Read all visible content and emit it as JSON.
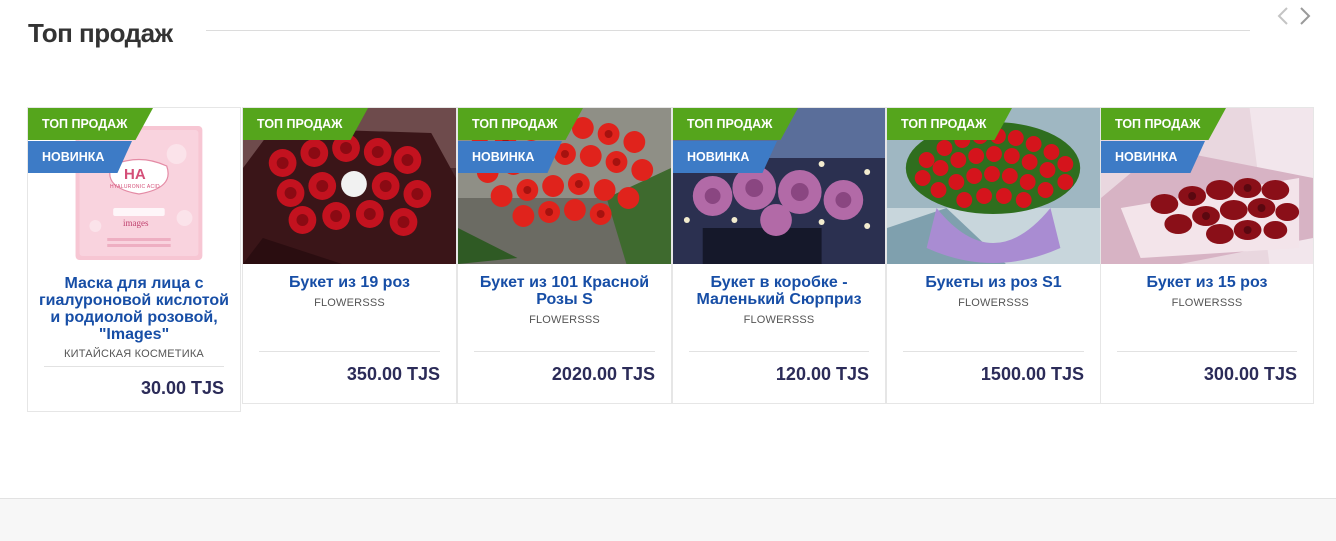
{
  "section": {
    "title": "Топ продаж"
  },
  "nav": {
    "prev_icon": "chevron-left-icon",
    "next_icon": "chevron-right-icon"
  },
  "colors": {
    "badge_top": "#55a51c",
    "badge_new": "#3d7bc6",
    "title": "#174ea6",
    "price": "#2b2b58"
  },
  "badges": {
    "top": "ТОП ПРОДАЖ",
    "new": "НОВИНКА"
  },
  "products": [
    {
      "title": "Маска для лица с гиалуроновой кислотой и родиолой розовой, \"Images\"",
      "vendor": "КИТАЙСКАЯ КОСМЕТИКА",
      "price": "30.00 TJS",
      "badges": [
        "top",
        "new"
      ],
      "image_text": {
        "brand": "HA",
        "sub": "HYALURONIC ACID",
        "logo": "images"
      }
    },
    {
      "title": "Букет из 19 роз",
      "vendor": "FLOWERSSS",
      "price": "350.00 TJS",
      "badges": [
        "top"
      ]
    },
    {
      "title": "Букет из 101 Красной Розы S",
      "vendor": "FLOWERSSS",
      "price": "2020.00 TJS",
      "badges": [
        "top",
        "new"
      ]
    },
    {
      "title": "Букет в коробке - Маленький Сюрприз",
      "vendor": "FLOWERSSS",
      "price": "120.00 TJS",
      "badges": [
        "top",
        "new"
      ]
    },
    {
      "title": "Букеты из роз S1",
      "vendor": "FLOWERSSS",
      "price": "1500.00 TJS",
      "badges": [
        "top"
      ]
    },
    {
      "title": "Букет из 15 роз",
      "vendor": "FLOWERSSS",
      "price": "300.00 TJS",
      "badges": [
        "top",
        "new"
      ]
    }
  ]
}
